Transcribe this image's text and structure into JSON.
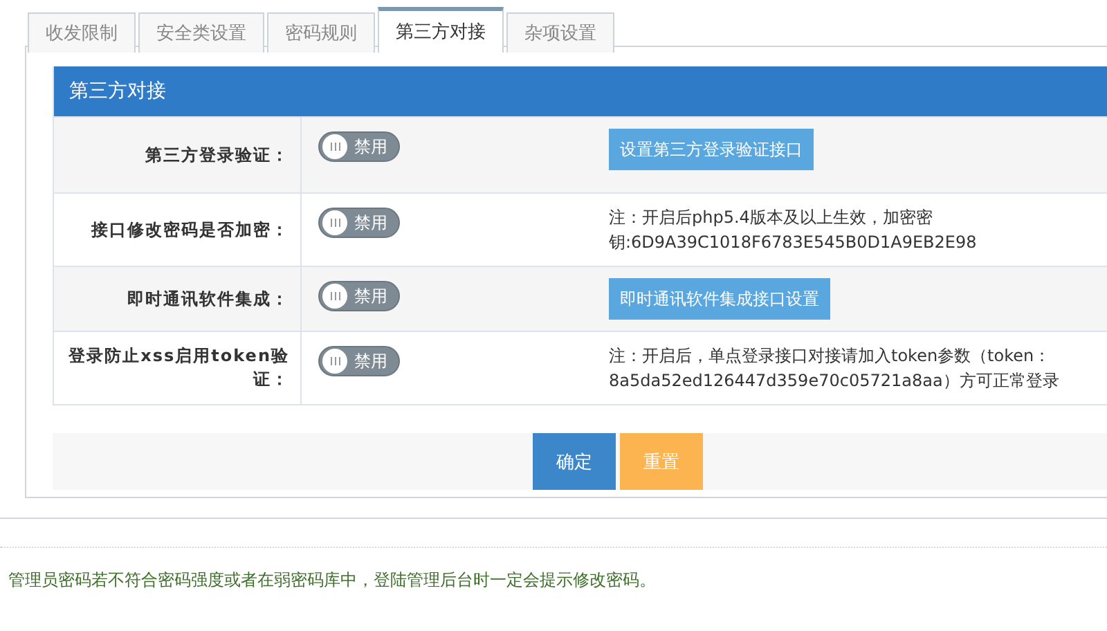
{
  "tabs": [
    {
      "label": "收发限制",
      "selected": false
    },
    {
      "label": "安全类设置",
      "selected": false
    },
    {
      "label": "密码规则",
      "selected": false
    },
    {
      "label": "第三方对接",
      "selected": true
    },
    {
      "label": "杂项设置",
      "selected": false
    }
  ],
  "section": {
    "title": "第三方对接",
    "rows": [
      {
        "label": "第三方登录验证：",
        "toggle": {
          "on": false,
          "text": "禁用"
        },
        "action": {
          "kind": "button",
          "text": "设置第三方登录验证接口"
        }
      },
      {
        "label": "接口修改密码是否加密：",
        "toggle": {
          "on": false,
          "text": "禁用"
        },
        "action": {
          "kind": "note",
          "text": "注：开启后php5.4版本及以上生效，加密密钥:6D9A39C1018F6783E545B0D1A9EB2E98"
        }
      },
      {
        "label": "即时通讯软件集成：",
        "toggle": {
          "on": false,
          "text": "禁用"
        },
        "action": {
          "kind": "button",
          "text": "即时通讯软件集成接口设置"
        }
      },
      {
        "label": "登录防止xss启用token验证：",
        "toggle": {
          "on": false,
          "text": "禁用"
        },
        "action": {
          "kind": "note",
          "text": "注：开启后，单点登录接口对接请加入token参数（token：8a5da52ed126447d359e70c05721a8aa）方可正常登录"
        }
      }
    ]
  },
  "buttons": [
    {
      "kind": "primary",
      "label": "确定"
    },
    {
      "kind": "warning",
      "label": "重置"
    }
  ],
  "footer_note": "管理员密码若不符合密码强度或者在弱密码库中，登陆管理后台时一定会提示修改密码。"
}
